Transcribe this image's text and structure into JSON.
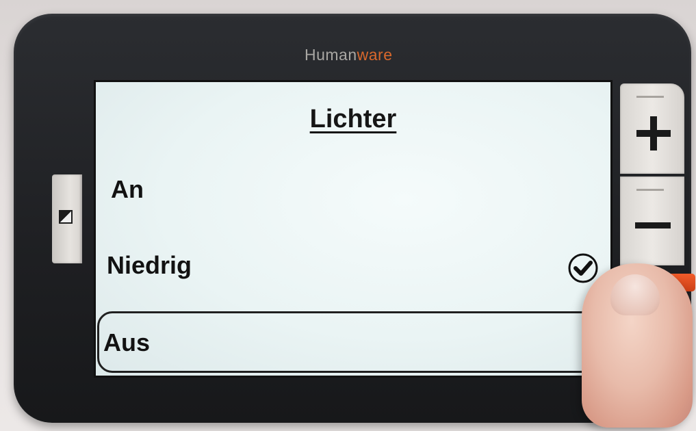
{
  "device": {
    "brand_prefix": "Human",
    "brand_accent": "ware",
    "accent_color": "#d9682c"
  },
  "screen": {
    "title": "Lichter",
    "options": [
      {
        "label": "An",
        "selected": false,
        "focused": false
      },
      {
        "label": "Niedrig",
        "selected": true,
        "focused": false
      },
      {
        "label": "Aus",
        "selected": false,
        "focused": true
      }
    ]
  },
  "icons": {
    "contrast": "contrast-icon",
    "check": "checkmark-icon",
    "plus": "plus-icon",
    "minus": "minus-icon",
    "power": "power-button"
  }
}
